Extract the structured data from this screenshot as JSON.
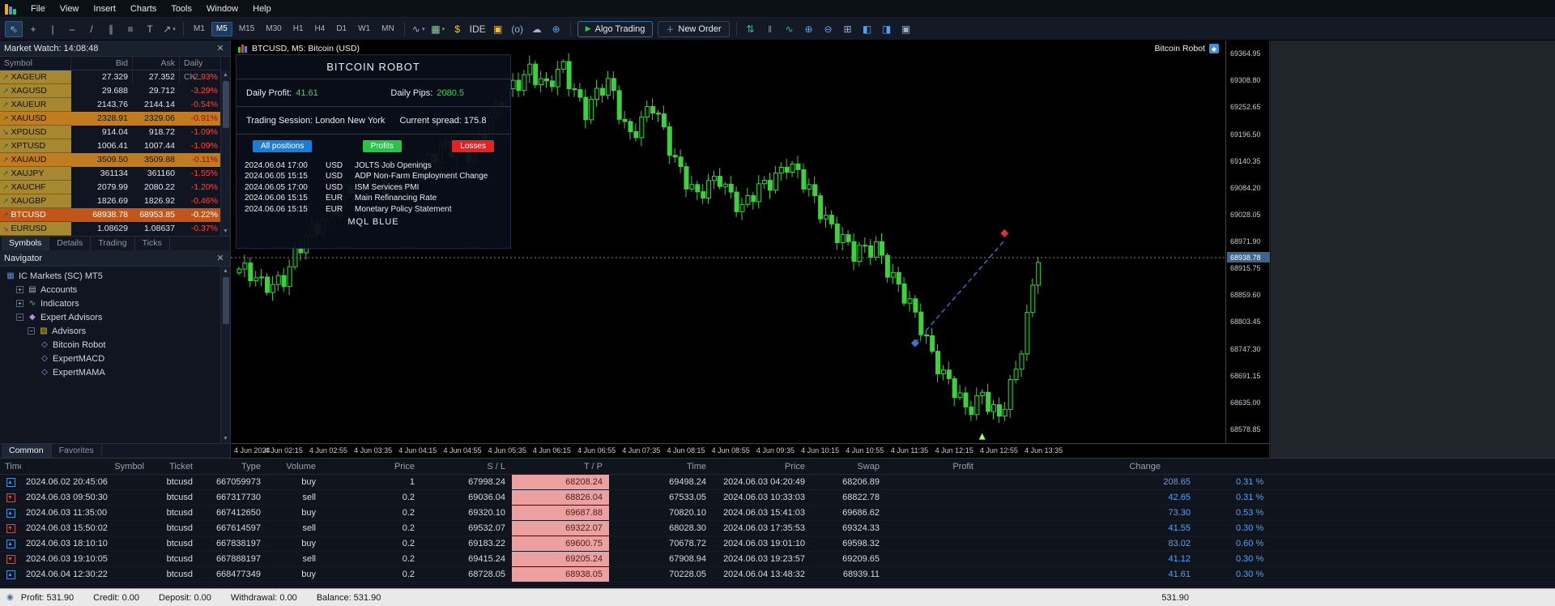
{
  "app_colors": {
    "accent_blue": "#1a7fd4",
    "profit_green": "#2edc50",
    "loss_red": "#e02424",
    "candle_green": "#3dd13d",
    "gold_row": "#c07c1e",
    "orange_row": "#c2551a"
  },
  "menu": {
    "items": [
      "File",
      "View",
      "Insert",
      "Charts",
      "Tools",
      "Window",
      "Help"
    ]
  },
  "toolbar": {
    "tools_left": [
      {
        "name": "cursor-icon",
        "glyph": "⇖",
        "color": "#7fb2e8",
        "pressed": true
      },
      {
        "name": "crosshair-icon",
        "glyph": "+",
        "color": "#9fb0c8"
      },
      {
        "name": "vertical-line-icon",
        "glyph": "|",
        "color": "#9fb0c8"
      },
      {
        "name": "horizontal-line-icon",
        "glyph": "–",
        "color": "#9fb0c8"
      },
      {
        "name": "trendline-icon",
        "glyph": "/",
        "color": "#9fb0c8"
      },
      {
        "name": "channel-icon",
        "glyph": "∥",
        "color": "#9fb0c8"
      },
      {
        "name": "fibonacci-icon",
        "glyph": "≡",
        "color": "#9fb0c8"
      },
      {
        "name": "text-icon",
        "glyph": "T",
        "color": "#9fb0c8"
      },
      {
        "name": "shapes-icon",
        "glyph": "↗",
        "color": "#9fb0c8",
        "dropdown": true
      }
    ],
    "timeframes": [
      "M1",
      "M5",
      "M15",
      "M30",
      "H1",
      "H4",
      "D1",
      "W1",
      "MN"
    ],
    "active_timeframe": "M5",
    "tools_mid": [
      {
        "name": "indicators-icon",
        "glyph": "∿",
        "color": "#8fb2d8",
        "dropdown": true
      },
      {
        "name": "chart-type-icon",
        "glyph": "▦",
        "color": "#8fd89f",
        "dropdown": true
      },
      {
        "name": "quotes-icon",
        "glyph": "$",
        "color": "#f0c040"
      },
      {
        "name": "ide-button",
        "glyph": "IDE",
        "color": "#c8d0dc"
      },
      {
        "name": "lock-icon",
        "glyph": "▣",
        "color": "#f0c040"
      },
      {
        "name": "signal-icon",
        "glyph": "(ο)",
        "color": "#9fb0c8"
      },
      {
        "name": "cloud-icon",
        "glyph": "☁",
        "color": "#9fb0c8"
      },
      {
        "name": "community-icon",
        "glyph": "⊕",
        "color": "#58a0e8"
      }
    ],
    "algo_trading_label": "Algo Trading",
    "new_order_label": "New Order",
    "tools_right": [
      {
        "name": "sort-icon",
        "glyph": "⇅",
        "color": "#30b89a"
      },
      {
        "name": "pause-bars-icon",
        "glyph": "‖",
        "color": "#30b89a"
      },
      {
        "name": "zigzag-icon",
        "glyph": "∿",
        "color": "#30b89a"
      },
      {
        "name": "zoom-in-icon",
        "glyph": "⊕",
        "color": "#58a0e8"
      },
      {
        "name": "zoom-out-icon",
        "glyph": "⊖",
        "color": "#58a0e8"
      },
      {
        "name": "tile-windows-icon",
        "glyph": "⊞",
        "color": "#9fb0c8"
      },
      {
        "name": "window-left-icon",
        "glyph": "◧",
        "color": "#58a0e8"
      },
      {
        "name": "window-right-icon",
        "glyph": "◨",
        "color": "#58a0e8"
      },
      {
        "name": "screenshot-icon",
        "glyph": "▣",
        "color": "#9fb0c8"
      }
    ]
  },
  "market_watch": {
    "title": "Market Watch: 14:08:48",
    "columns": [
      "Symbol",
      "Bid",
      "Ask",
      "Daily Ch..."
    ],
    "rows": [
      {
        "symbol": "XAGEUR",
        "bid": "27.329",
        "ask": "27.352",
        "change": "-2.93%",
        "dir": "up",
        "hl": ""
      },
      {
        "symbol": "XAGUSD",
        "bid": "29.688",
        "ask": "29.712",
        "change": "-3.29%",
        "dir": "up",
        "hl": ""
      },
      {
        "symbol": "XAUEUR",
        "bid": "2143.76",
        "ask": "2144.14",
        "change": "-0.54%",
        "dir": "up",
        "hl": ""
      },
      {
        "symbol": "XAUUSD",
        "bid": "2328.91",
        "ask": "2329.06",
        "change": "-0.91%",
        "dir": "up",
        "hl": "gold"
      },
      {
        "symbol": "XPDUSD",
        "bid": "914.04",
        "ask": "918.72",
        "change": "-1.09%",
        "dir": "down",
        "hl": ""
      },
      {
        "symbol": "XPTUSD",
        "bid": "1006.41",
        "ask": "1007.44",
        "change": "-1.09%",
        "dir": "up",
        "hl": ""
      },
      {
        "symbol": "XAUAUD",
        "bid": "3509.50",
        "ask": "3509.88",
        "change": "-0.11%",
        "dir": "up",
        "hl": "gold"
      },
      {
        "symbol": "XAUJPY",
        "bid": "361134",
        "ask": "361160",
        "change": "-1.55%",
        "dir": "up",
        "hl": ""
      },
      {
        "symbol": "XAUCHF",
        "bid": "2079.99",
        "ask": "2080.22",
        "change": "-1.20%",
        "dir": "up",
        "hl": ""
      },
      {
        "symbol": "XAUGBP",
        "bid": "1826.69",
        "ask": "1826.92",
        "change": "-0.46%",
        "dir": "up",
        "hl": ""
      },
      {
        "symbol": "BTCUSD",
        "bid": "68938.78",
        "ask": "68953.85",
        "change": "-0.22%",
        "dir": "up",
        "hl": "orange"
      },
      {
        "symbol": "EURUSD",
        "bid": "1.08629",
        "ask": "1.08637",
        "change": "-0.37%",
        "dir": "down",
        "hl": ""
      }
    ],
    "tabs": [
      "Symbols",
      "Details",
      "Trading",
      "Ticks"
    ],
    "active_tab": "Symbols"
  },
  "navigator": {
    "title": "Navigator",
    "tree": [
      {
        "label": "IC Markets (SC) MT5",
        "level": 0,
        "box": "none",
        "icon": "server-icon",
        "glyph": "▦",
        "color": "#4a90d9"
      },
      {
        "label": "Accounts",
        "level": 1,
        "box": "plus",
        "icon": "accounts-icon",
        "glyph": "▤",
        "color": "#9fb0c8"
      },
      {
        "label": "Indicators",
        "level": 1,
        "box": "plus",
        "icon": "indicators-icon",
        "glyph": "∿",
        "color": "#50b8a8"
      },
      {
        "label": "Expert Advisors",
        "level": 1,
        "box": "minus",
        "icon": "experts-icon",
        "glyph": "◆",
        "color": "#b08fe0"
      },
      {
        "label": "Advisors",
        "level": 2,
        "box": "minus",
        "icon": "folder-icon",
        "glyph": "▨",
        "color": "#e8c040"
      },
      {
        "label": "Bitcoin Robot",
        "level": 3,
        "box": "none",
        "icon": "ea-icon",
        "glyph": "◇",
        "color": "#7fb2e8"
      },
      {
        "label": "ExpertMACD",
        "level": 3,
        "box": "none",
        "icon": "ea-icon",
        "glyph": "◇",
        "color": "#7fb2e8"
      },
      {
        "label": "ExpertMAMA",
        "level": 3,
        "box": "none",
        "icon": "ea-icon",
        "glyph": "◇",
        "color": "#7fb2e8"
      }
    ],
    "tabs": [
      "Common",
      "Favorites"
    ],
    "active_tab": "Common"
  },
  "chart": {
    "title": "BTCUSD, M5:  Bitcoin (USD)",
    "ea_label": "Bitcoin Robot",
    "current_price_text": "68938.78"
  },
  "robot_panel": {
    "title": "BITCOIN ROBOT",
    "daily_profit_label": "Daily Profit:",
    "daily_profit": "41.61",
    "daily_pips_label": "Daily Pips:",
    "daily_pips": "2080.5",
    "session_text": "Trading Session: London New York",
    "spread_text": "Current spread: 175.8",
    "btn_all": "All positions",
    "btn_profits": "Profits",
    "btn_losses": "Losses",
    "news": [
      {
        "date": "2024.06.04 17:00",
        "cur": "USD",
        "event": "JOLTS Job Openings"
      },
      {
        "date": "2024.06.05 15:15",
        "cur": "USD",
        "event": "ADP Non-Farm Employment Change"
      },
      {
        "date": "2024.06.05 17:00",
        "cur": "USD",
        "event": "ISM Services PMI"
      },
      {
        "date": "2024.06.06 15:15",
        "cur": "EUR",
        "event": "Main Refinancing Rate"
      },
      {
        "date": "2024.06.06 15:15",
        "cur": "EUR",
        "event": "Monetary Policy Statement"
      }
    ],
    "footer": "MQL BLUE"
  },
  "chart_data": {
    "type": "candlestick",
    "symbol": "BTCUSD",
    "timeframe": "M5",
    "ylim": [
      68550.8,
      69393.0
    ],
    "price_labels": [
      "69364.95",
      "69308.80",
      "69252.65",
      "69196.50",
      "69140.35",
      "69084.20",
      "69028.05",
      "68971.90",
      "68915.75",
      "68859.60",
      "68803.45",
      "68747.30",
      "68691.15",
      "68635.00",
      "68578.85"
    ],
    "current_price": 68938.78,
    "time_labels": [
      "4 Jun 2024",
      "4 Jun 02:15",
      "4 Jun 02:55",
      "4 Jun 03:35",
      "4 Jun 04:15",
      "4 Jun 04:55",
      "4 Jun 05:35",
      "4 Jun 06:15",
      "4 Jun 06:55",
      "4 Jun 07:35",
      "4 Jun 08:15",
      "4 Jun 08:55",
      "4 Jun 09:35",
      "4 Jun 10:15",
      "4 Jun 10:55",
      "4 Jun 11:35",
      "4 Jun 12:15",
      "4 Jun 12:55",
      "4 Jun 13:35"
    ],
    "candle_count": 144,
    "candles_per_label": 8,
    "up_color": "#3dd13d",
    "waypoints": [
      [
        0,
        68915
      ],
      [
        4,
        68880
      ],
      [
        8,
        68900
      ],
      [
        12,
        68975
      ],
      [
        16,
        69040
      ],
      [
        20,
        69080
      ],
      [
        24,
        69120
      ],
      [
        28,
        69070
      ],
      [
        32,
        69130
      ],
      [
        36,
        69170
      ],
      [
        40,
        69145
      ],
      [
        44,
        69210
      ],
      [
        48,
        69280
      ],
      [
        52,
        69340
      ],
      [
        55,
        69290
      ],
      [
        58,
        69335
      ],
      [
        62,
        69250
      ],
      [
        66,
        69300
      ],
      [
        70,
        69200
      ],
      [
        74,
        69250
      ],
      [
        78,
        69150
      ],
      [
        82,
        69060
      ],
      [
        86,
        69110
      ],
      [
        90,
        69040
      ],
      [
        94,
        69090
      ],
      [
        98,
        69140
      ],
      [
        102,
        69075
      ],
      [
        106,
        69010
      ],
      [
        110,
        68940
      ],
      [
        114,
        68970
      ],
      [
        118,
        68870
      ],
      [
        122,
        68800
      ],
      [
        126,
        68690
      ],
      [
        130,
        68620
      ],
      [
        133,
        68660
      ],
      [
        136,
        68595
      ],
      [
        139,
        68700
      ],
      [
        141,
        68820
      ],
      [
        143,
        68950
      ]
    ],
    "trend_line": {
      "from_candle": 121,
      "from_price": 68760,
      "to_candle": 137,
      "to_price": 68975,
      "color": "#3f6fd9"
    },
    "markers": [
      {
        "candle": 121,
        "price": 68760,
        "shape": "diamond",
        "color": "#3f6fd9"
      },
      {
        "candle": 137,
        "price": 68990,
        "shape": "diamond",
        "color": "#e03030"
      },
      {
        "candle": 133,
        "price": 68565,
        "shape": "triangle-up",
        "color": "#a8ff60"
      }
    ]
  },
  "toolbox": {
    "columns": [
      "Time",
      "Symbol",
      "Ticket",
      "Type",
      "Volume",
      "Price",
      "S / L",
      "T / P",
      "Time",
      "Price",
      "Swap",
      "Profit",
      "Change"
    ],
    "rows": [
      {
        "open_time": "2024.06.02 20:45:06",
        "symbol": "btcusd",
        "ticket": "667059973",
        "type": "buy",
        "volume": "1",
        "price_open": "67998.24",
        "sl": "68208.24",
        "tp": "69498.24",
        "close_time": "2024.06.03 04:20:49",
        "price_close": "68206.89",
        "swap": "",
        "profit": "208.65",
        "change": "0.31 %"
      },
      {
        "open_time": "2024.06.03 09:50:30",
        "symbol": "btcusd",
        "ticket": "667317730",
        "type": "sell",
        "volume": "0.2",
        "price_open": "69036.04",
        "sl": "68826.04",
        "tp": "67533.05",
        "close_time": "2024.06.03 10:33:03",
        "price_close": "68822.78",
        "swap": "",
        "profit": "42.65",
        "change": "0.31 %"
      },
      {
        "open_time": "2024.06.03 11:35:00",
        "symbol": "btcusd",
        "ticket": "667412650",
        "type": "buy",
        "volume": "0.2",
        "price_open": "69320.10",
        "sl": "69687.88",
        "tp": "70820.10",
        "close_time": "2024.06.03 15:41:03",
        "price_close": "69686.62",
        "swap": "",
        "profit": "73.30",
        "change": "0.53 %"
      },
      {
        "open_time": "2024.06.03 15:50:02",
        "symbol": "btcusd",
        "ticket": "667614597",
        "type": "sell",
        "volume": "0.2",
        "price_open": "69532.07",
        "sl": "69322.07",
        "tp": "68028.30",
        "close_time": "2024.06.03 17:35:53",
        "price_close": "69324.33",
        "swap": "",
        "profit": "41.55",
        "change": "0.30 %"
      },
      {
        "open_time": "2024.06.03 18:10:10",
        "symbol": "btcusd",
        "ticket": "667838197",
        "type": "buy",
        "volume": "0.2",
        "price_open": "69183.22",
        "sl": "69600.75",
        "tp": "70678.72",
        "close_time": "2024.06.03 19:01:10",
        "price_close": "69598.32",
        "swap": "",
        "profit": "83.02",
        "change": "0.60 %"
      },
      {
        "open_time": "2024.06.03 19:10:05",
        "symbol": "btcusd",
        "ticket": "667888197",
        "type": "sell",
        "volume": "0.2",
        "price_open": "69415.24",
        "sl": "69205.24",
        "tp": "67908.94",
        "close_time": "2024.06.03 19:23:57",
        "price_close": "69209.65",
        "swap": "",
        "profit": "41.12",
        "change": "0.30 %"
      },
      {
        "open_time": "2024.06.04 12:30:22",
        "symbol": "btcusd",
        "ticket": "668477349",
        "type": "buy",
        "volume": "0.2",
        "price_open": "68728.05",
        "sl": "68938.05",
        "tp": "70228.05",
        "close_time": "2024.06.04 13:48:32",
        "price_close": "68939.11",
        "swap": "",
        "profit": "41.61",
        "change": "0.30 %"
      }
    ]
  },
  "status_bar": {
    "items": [
      "Profit: 531.90",
      "Credit: 0.00",
      "Deposit: 0.00",
      "Withdrawal: 0.00",
      "Balance: 531.90"
    ],
    "right": "531.90"
  }
}
